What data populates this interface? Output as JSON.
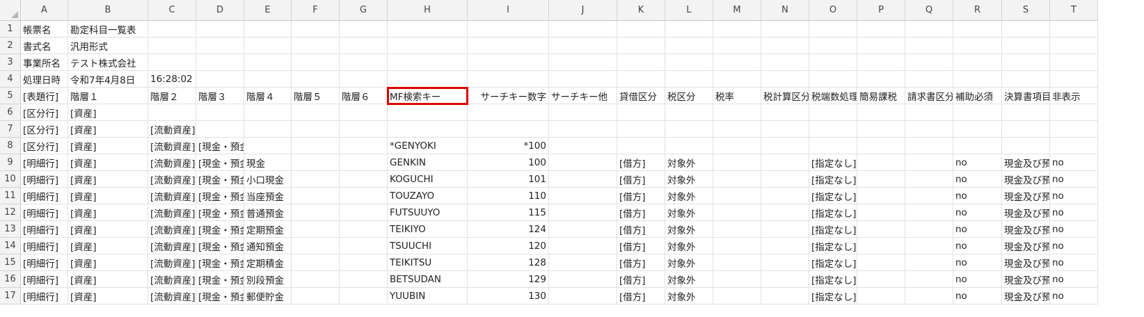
{
  "columns": [
    "A",
    "B",
    "C",
    "D",
    "E",
    "F",
    "G",
    "H",
    "I",
    "J",
    "K",
    "L",
    "M",
    "N",
    "O",
    "P",
    "Q",
    "R",
    "S",
    "T"
  ],
  "rows": [
    {
      "num": "1",
      "cells": [
        "帳票名",
        "勘定科目一覧表",
        "",
        "",
        "",
        "",
        "",
        "",
        "",
        "",
        "",
        "",
        "",
        "",
        "",
        "",
        "",
        "",
        "",
        ""
      ]
    },
    {
      "num": "2",
      "cells": [
        "書式名",
        "汎用形式",
        "",
        "",
        "",
        "",
        "",
        "",
        "",
        "",
        "",
        "",
        "",
        "",
        "",
        "",
        "",
        "",
        "",
        ""
      ]
    },
    {
      "num": "3",
      "cells": [
        "事業所名",
        "テスト株式会社",
        "",
        "",
        "",
        "",
        "",
        "",
        "",
        "",
        "",
        "",
        "",
        "",
        "",
        "",
        "",
        "",
        "",
        ""
      ]
    },
    {
      "num": "4",
      "cells": [
        "処理日時",
        "令和7年4月8日",
        "16:28:02",
        "",
        "",
        "",
        "",
        "",
        "",
        "",
        "",
        "",
        "",
        "",
        "",
        "",
        "",
        "",
        "",
        ""
      ]
    },
    {
      "num": "5",
      "cells": [
        "[表題行]",
        "階層１",
        "階層２",
        "階層３",
        "階層４",
        "階層５",
        "階層６",
        "MF検索キー",
        "サーチキー数字",
        "サーチキー他",
        "貸借区分",
        "税区分",
        "税率",
        "税計算区分",
        "税端数処理",
        "簡易課税",
        "請求書区分",
        "補助必須",
        "決算書項目",
        "非表示"
      ]
    },
    {
      "num": "6",
      "cells": [
        "[区分行]",
        "[資産]",
        "",
        "",
        "",
        "",
        "",
        "",
        "",
        "",
        "",
        "",
        "",
        "",
        "",
        "",
        "",
        "",
        "",
        ""
      ]
    },
    {
      "num": "7",
      "cells": [
        "[区分行]",
        "[資産]",
        "[流動資産]",
        "",
        "",
        "",
        "",
        "",
        "",
        "",
        "",
        "",
        "",
        "",
        "",
        "",
        "",
        "",
        "",
        ""
      ]
    },
    {
      "num": "8",
      "cells": [
        "[区分行]",
        "[資産]",
        "[流動資産]",
        "[現金・預金]",
        "",
        "",
        "",
        "*GENYOKI",
        "*100",
        "",
        "",
        "",
        "",
        "",
        "",
        "",
        "",
        "",
        "",
        ""
      ]
    },
    {
      "num": "9",
      "cells": [
        "[明細行]",
        "[資産]",
        "[流動資産]",
        "[現金・預金]",
        "現金",
        "",
        "",
        "GENKIN",
        "100",
        "",
        "[借方]",
        "対象外",
        "",
        "",
        "[指定なし]",
        "",
        "",
        "no",
        "現金及び預金",
        "no"
      ]
    },
    {
      "num": "10",
      "cells": [
        "[明細行]",
        "[資産]",
        "[流動資産]",
        "[現金・預金]",
        "小口現金",
        "",
        "",
        "KOGUCHI",
        "101",
        "",
        "[借方]",
        "対象外",
        "",
        "",
        "[指定なし]",
        "",
        "",
        "no",
        "現金及び預金",
        "no"
      ]
    },
    {
      "num": "11",
      "cells": [
        "[明細行]",
        "[資産]",
        "[流動資産]",
        "[現金・預金]",
        "当座預金",
        "",
        "",
        "TOUZAYO",
        "110",
        "",
        "[借方]",
        "対象外",
        "",
        "",
        "[指定なし]",
        "",
        "",
        "no",
        "現金及び預金",
        "no"
      ]
    },
    {
      "num": "12",
      "cells": [
        "[明細行]",
        "[資産]",
        "[流動資産]",
        "[現金・預金]",
        "普通預金",
        "",
        "",
        "FUTSUUYO",
        "115",
        "",
        "[借方]",
        "対象外",
        "",
        "",
        "[指定なし]",
        "",
        "",
        "no",
        "現金及び預金",
        "no"
      ]
    },
    {
      "num": "13",
      "cells": [
        "[明細行]",
        "[資産]",
        "[流動資産]",
        "[現金・預金]",
        "定期預金",
        "",
        "",
        "TEIKIYO",
        "124",
        "",
        "[借方]",
        "対象外",
        "",
        "",
        "[指定なし]",
        "",
        "",
        "no",
        "現金及び預金",
        "no"
      ]
    },
    {
      "num": "14",
      "cells": [
        "[明細行]",
        "[資産]",
        "[流動資産]",
        "[現金・預金]",
        "通知預金",
        "",
        "",
        "TSUUCHI",
        "120",
        "",
        "[借方]",
        "対象外",
        "",
        "",
        "[指定なし]",
        "",
        "",
        "no",
        "現金及び預金",
        "no"
      ]
    },
    {
      "num": "15",
      "cells": [
        "[明細行]",
        "[資産]",
        "[流動資産]",
        "[現金・預金]",
        "定期積金",
        "",
        "",
        "TEIKITSU",
        "128",
        "",
        "[借方]",
        "対象外",
        "",
        "",
        "[指定なし]",
        "",
        "",
        "no",
        "現金及び預金",
        "no"
      ]
    },
    {
      "num": "16",
      "cells": [
        "[明細行]",
        "[資産]",
        "[流動資産]",
        "[現金・預金]",
        "別段預金",
        "",
        "",
        "BETSUDAN",
        "129",
        "",
        "[借方]",
        "対象外",
        "",
        "",
        "[指定なし]",
        "",
        "",
        "no",
        "現金及び預金",
        "no"
      ]
    },
    {
      "num": "17",
      "cells": [
        "[明細行]",
        "[資産]",
        "[流動資産]",
        "[現金・預金]",
        "郵便貯金",
        "",
        "",
        "YUUBIN",
        "130",
        "",
        "[借方]",
        "対象外",
        "",
        "",
        "[指定なし]",
        "",
        "",
        "no",
        "現金及び預金",
        "no"
      ]
    }
  ],
  "selection": {
    "cell": "H5",
    "color": "#e00000"
  },
  "colors": {
    "header_bg": "#f3f3f3",
    "gridline": "#e1e1e1",
    "selection_border": "#e00000"
  }
}
